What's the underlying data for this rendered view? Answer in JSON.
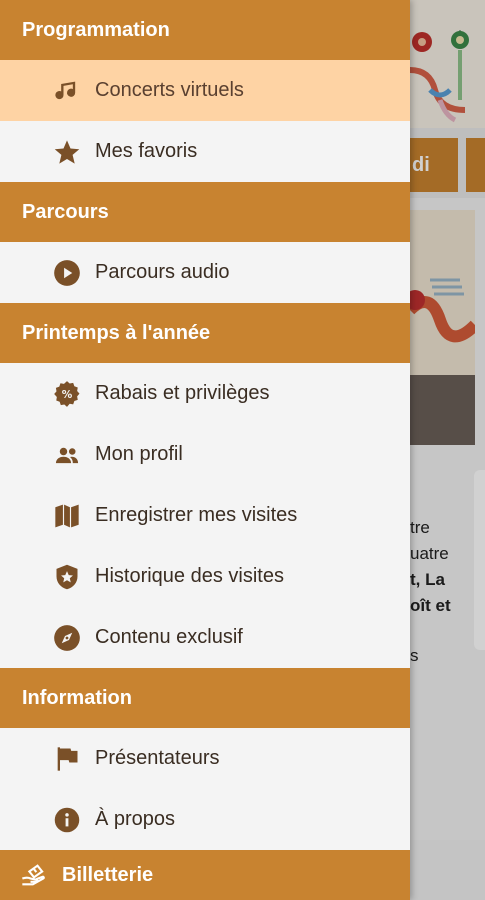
{
  "drawer": {
    "sections": [
      {
        "title": "Programmation",
        "items": [
          {
            "label": "Concerts virtuels",
            "icon": "music-note-icon",
            "active": true
          },
          {
            "label": "Mes favoris",
            "icon": "star-icon",
            "active": false
          }
        ]
      },
      {
        "title": "Parcours",
        "items": [
          {
            "label": "Parcours audio",
            "icon": "play-circle-icon",
            "active": false
          }
        ]
      },
      {
        "title": "Printemps à l'année",
        "items": [
          {
            "label": "Rabais et privilèges",
            "icon": "discount-badge-icon",
            "active": false
          },
          {
            "label": "Mon profil",
            "icon": "people-icon",
            "active": false
          },
          {
            "label": "Enregistrer mes visites",
            "icon": "map-icon",
            "active": false
          },
          {
            "label": "Historique des visites",
            "icon": "shield-star-icon",
            "active": false
          },
          {
            "label": "Contenu exclusif",
            "icon": "compass-icon",
            "active": false
          }
        ]
      },
      {
        "title": "Information",
        "items": [
          {
            "label": "Présentateurs",
            "icon": "flag-icon",
            "active": false
          },
          {
            "label": "À propos",
            "icon": "info-icon",
            "active": false
          }
        ]
      }
    ],
    "footer": {
      "label": "Billetterie",
      "icon": "ticket-hand-icon"
    }
  },
  "background": {
    "tab_partial": "di",
    "text_lines": [
      "tre",
      "uatre",
      "t, La",
      "oît et",
      "s"
    ]
  },
  "colors": {
    "section_header": "#c88330",
    "active_item": "#fed3a4",
    "icon": "#7a5028"
  }
}
